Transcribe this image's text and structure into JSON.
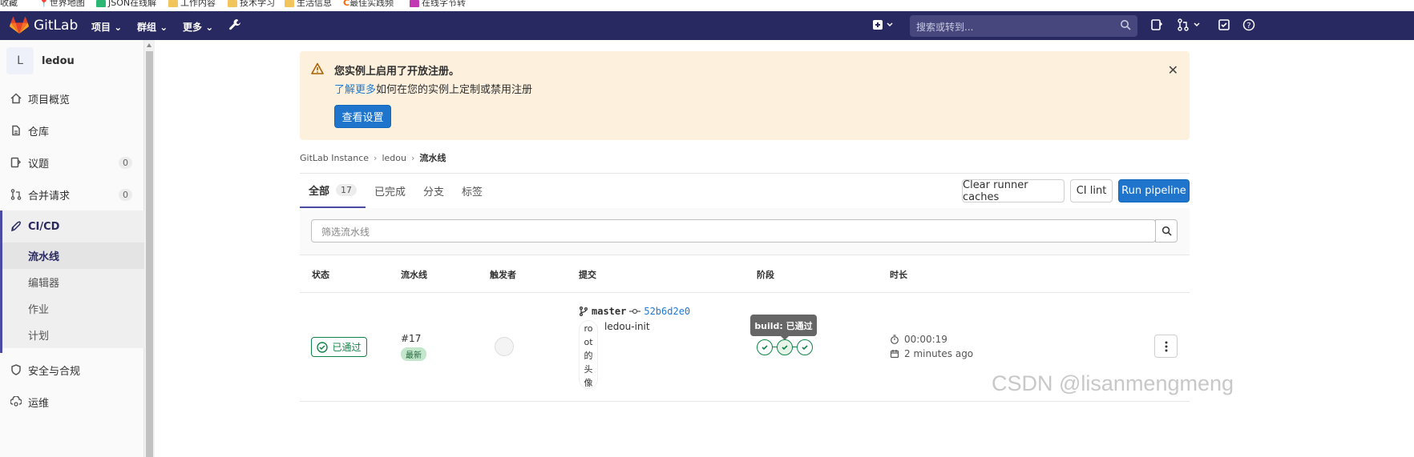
{
  "bookmarks": [
    "收藏",
    "世界地图",
    "JSON在线解",
    "工作内容",
    "技术学习",
    "生活信息",
    "最佳实践频",
    "在线字节转"
  ],
  "topnav": {
    "brand": "GitLab",
    "menus": [
      "项目",
      "群组",
      "更多"
    ],
    "search_placeholder": "搜索或转到..."
  },
  "sidebar": {
    "project_initial": "L",
    "project_name": "ledou",
    "items": [
      {
        "label": "项目概览"
      },
      {
        "label": "仓库"
      },
      {
        "label": "议题",
        "count": "0"
      },
      {
        "label": "合并请求",
        "count": "0"
      },
      {
        "label": "CI/CD"
      },
      {
        "label": "安全与合规"
      },
      {
        "label": "运维"
      }
    ],
    "cicd_sub": [
      "流水线",
      "编辑器",
      "作业",
      "计划"
    ]
  },
  "banner": {
    "title": "您实例上启用了开放注册。",
    "link_text": "了解更多",
    "text": "如何在您的实例上定制或禁用注册",
    "button": "查看设置"
  },
  "breadcrumb": [
    "GitLab Instance",
    "ledou",
    "流水线"
  ],
  "tabs": [
    {
      "label": "全部",
      "count": "17"
    },
    {
      "label": "已完成"
    },
    {
      "label": "分支"
    },
    {
      "label": "标签"
    }
  ],
  "actions": {
    "clear_cache": "Clear runner caches",
    "ci_lint": "CI lint",
    "run_pipeline": "Run pipeline"
  },
  "filter_placeholder": "筛选流水线",
  "table": {
    "headers": [
      "状态",
      "流水线",
      "触发者",
      "提交",
      "阶段",
      "时长"
    ],
    "row": {
      "status": "已通过",
      "pipeline_id": "#17",
      "latest_badge": "最新",
      "branch": "master",
      "sha": "52b6d2e0",
      "avatar_alt": "root的头像",
      "commit_message": "ledou-init",
      "stage_tooltip": "build: 已通过",
      "duration": "00:00:19",
      "finished": "2 minutes ago"
    }
  },
  "watermark": "CSDN @lisanmengmeng",
  "colors": {
    "nav_bg": "#292961",
    "primary": "#1f75cb",
    "success": "#108548",
    "banner_bg": "#fdf1dd"
  }
}
